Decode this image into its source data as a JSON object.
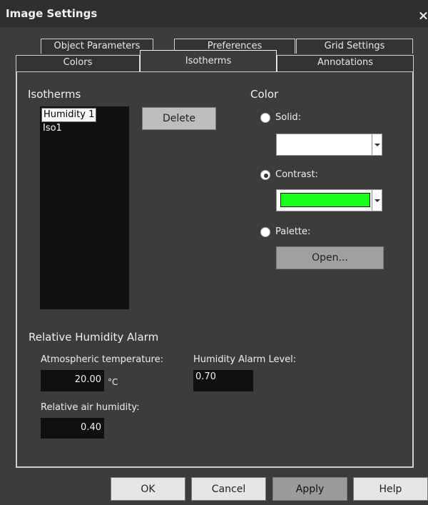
{
  "window": {
    "title": "Image Settings",
    "close_symbol": "×"
  },
  "tabs": {
    "row1": [
      "Object Parameters",
      "Preferences",
      "Grid Settings"
    ],
    "row2": [
      "Colors",
      "Isotherms",
      "Annotations"
    ],
    "active": "Isotherms"
  },
  "isotherms": {
    "heading": "Isotherms",
    "items": [
      "Humidity 1",
      "Iso1"
    ],
    "selected": "Humidity 1",
    "delete_label": "Delete"
  },
  "color": {
    "heading": "Color",
    "solid_label": "Solid:",
    "contrast_label": "Contrast:",
    "palette_label": "Palette:",
    "open_label": "Open...",
    "selected_option": "Contrast",
    "contrast_color": "#19ff19"
  },
  "humidity_alarm": {
    "heading": "Relative Humidity Alarm",
    "atmospheric_temperature_label": "Atmospheric temperature:",
    "atmospheric_temperature_value": "20.00",
    "temperature_unit": "°C",
    "humidity_alarm_level_label": "Humidity Alarm Level:",
    "humidity_alarm_level_value": "0.70",
    "relative_air_humidity_label": "Relative air humidity:",
    "relative_air_humidity_value": "0.40"
  },
  "buttons": {
    "ok": "OK",
    "cancel": "Cancel",
    "apply": "Apply",
    "help": "Help"
  }
}
